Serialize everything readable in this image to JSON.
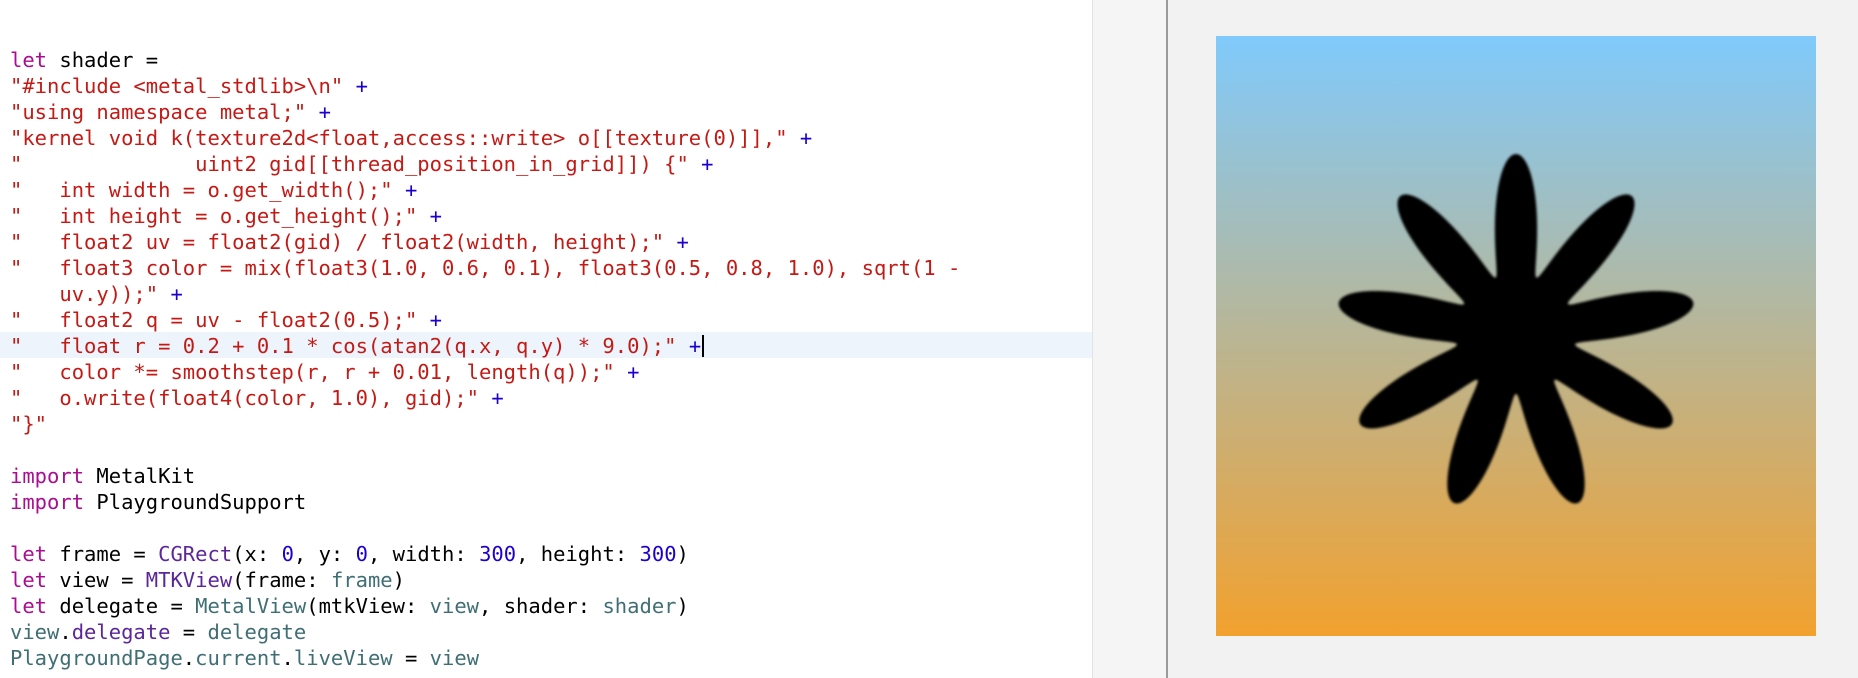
{
  "editor": {
    "lines": [
      [
        {
          "k": "kw",
          "t": "let"
        },
        {
          "k": "plain",
          "t": " shader ="
        }
      ],
      [
        {
          "k": "str",
          "t": "\"#include <metal_stdlib>\\n\""
        },
        {
          "k": "plain",
          "t": " "
        },
        {
          "k": "op",
          "t": "+"
        }
      ],
      [
        {
          "k": "str",
          "t": "\"using namespace metal;\""
        },
        {
          "k": "plain",
          "t": " "
        },
        {
          "k": "op",
          "t": "+"
        }
      ],
      [
        {
          "k": "str",
          "t": "\"kernel void k(texture2d<float,access::write> o[[texture(0)]],\""
        },
        {
          "k": "plain",
          "t": " "
        },
        {
          "k": "op",
          "t": "+"
        }
      ],
      [
        {
          "k": "str",
          "t": "\"              uint2 gid[[thread_position_in_grid]]) {\""
        },
        {
          "k": "plain",
          "t": " "
        },
        {
          "k": "op",
          "t": "+"
        }
      ],
      [
        {
          "k": "str",
          "t": "\"   int width = o.get_width();\""
        },
        {
          "k": "plain",
          "t": " "
        },
        {
          "k": "op",
          "t": "+"
        }
      ],
      [
        {
          "k": "str",
          "t": "\"   int height = o.get_height();\""
        },
        {
          "k": "plain",
          "t": " "
        },
        {
          "k": "op",
          "t": "+"
        }
      ],
      [
        {
          "k": "str",
          "t": "\"   float2 uv = float2(gid) / float2(width, height);\""
        },
        {
          "k": "plain",
          "t": " "
        },
        {
          "k": "op",
          "t": "+"
        }
      ],
      [
        {
          "k": "str",
          "t": "\"   float3 color = mix(float3(1.0, 0.6, 0.1), float3(0.5, 0.8, 1.0), sqrt(1 -"
        }
      ],
      [
        {
          "k": "str",
          "t": "    uv.y));\""
        },
        {
          "k": "plain",
          "t": " "
        },
        {
          "k": "op",
          "t": "+"
        }
      ],
      [
        {
          "k": "str",
          "t": "\"   float2 q = uv - float2(0.5);\""
        },
        {
          "k": "plain",
          "t": " "
        },
        {
          "k": "op",
          "t": "+"
        }
      ],
      [
        {
          "k": "str",
          "t": "\"   float r = 0.2 + 0.1 * cos(atan2(q.x, q.y) * 9.0);\""
        },
        {
          "k": "plain",
          "t": " "
        },
        {
          "k": "op",
          "t": "+"
        }
      ],
      [
        {
          "k": "str",
          "t": "\"   color *= smoothstep(r, r + 0.01, length(q));\""
        },
        {
          "k": "plain",
          "t": " "
        },
        {
          "k": "op",
          "t": "+"
        }
      ],
      [
        {
          "k": "str",
          "t": "\"   o.write(float4(color, 1.0), gid);\""
        },
        {
          "k": "plain",
          "t": " "
        },
        {
          "k": "op",
          "t": "+"
        }
      ],
      [
        {
          "k": "str",
          "t": "\"}\""
        }
      ],
      [],
      [
        {
          "k": "kw",
          "t": "import"
        },
        {
          "k": "plain",
          "t": " MetalKit"
        }
      ],
      [
        {
          "k": "kw",
          "t": "import"
        },
        {
          "k": "plain",
          "t": " PlaygroundSupport"
        }
      ],
      [],
      [
        {
          "k": "kw",
          "t": "let"
        },
        {
          "k": "plain",
          "t": " frame = "
        },
        {
          "k": "type",
          "t": "CGRect"
        },
        {
          "k": "plain",
          "t": "(x: "
        },
        {
          "k": "num",
          "t": "0"
        },
        {
          "k": "plain",
          "t": ", y: "
        },
        {
          "k": "num",
          "t": "0"
        },
        {
          "k": "plain",
          "t": ", width: "
        },
        {
          "k": "num",
          "t": "300"
        },
        {
          "k": "plain",
          "t": ", height: "
        },
        {
          "k": "num",
          "t": "300"
        },
        {
          "k": "plain",
          "t": ")"
        }
      ],
      [
        {
          "k": "kw",
          "t": "let"
        },
        {
          "k": "plain",
          "t": " view = "
        },
        {
          "k": "type",
          "t": "MTKView"
        },
        {
          "k": "plain",
          "t": "(frame: "
        },
        {
          "k": "proj",
          "t": "frame"
        },
        {
          "k": "plain",
          "t": ")"
        }
      ],
      [
        {
          "k": "kw",
          "t": "let"
        },
        {
          "k": "plain",
          "t": " delegate = "
        },
        {
          "k": "proj",
          "t": "MetalView"
        },
        {
          "k": "plain",
          "t": "(mtkView: "
        },
        {
          "k": "proj",
          "t": "view"
        },
        {
          "k": "plain",
          "t": ", shader: "
        },
        {
          "k": "proj",
          "t": "shader"
        },
        {
          "k": "plain",
          "t": ")"
        }
      ],
      [
        {
          "k": "proj",
          "t": "view"
        },
        {
          "k": "plain",
          "t": "."
        },
        {
          "k": "type",
          "t": "delegate"
        },
        {
          "k": "plain",
          "t": " = "
        },
        {
          "k": "proj",
          "t": "delegate"
        }
      ],
      [
        {
          "k": "proj",
          "t": "PlaygroundPage"
        },
        {
          "k": "plain",
          "t": "."
        },
        {
          "k": "proj",
          "t": "current"
        },
        {
          "k": "plain",
          "t": "."
        },
        {
          "k": "proj",
          "t": "liveView"
        },
        {
          "k": "plain",
          "t": " = "
        },
        {
          "k": "proj",
          "t": "view"
        }
      ]
    ],
    "highlighted_line": 11
  },
  "live_view": {
    "gradient_top": "#80cafc",
    "gradient_bottom": "#f2a12e",
    "shape_color": "#000000",
    "petals": 9
  }
}
